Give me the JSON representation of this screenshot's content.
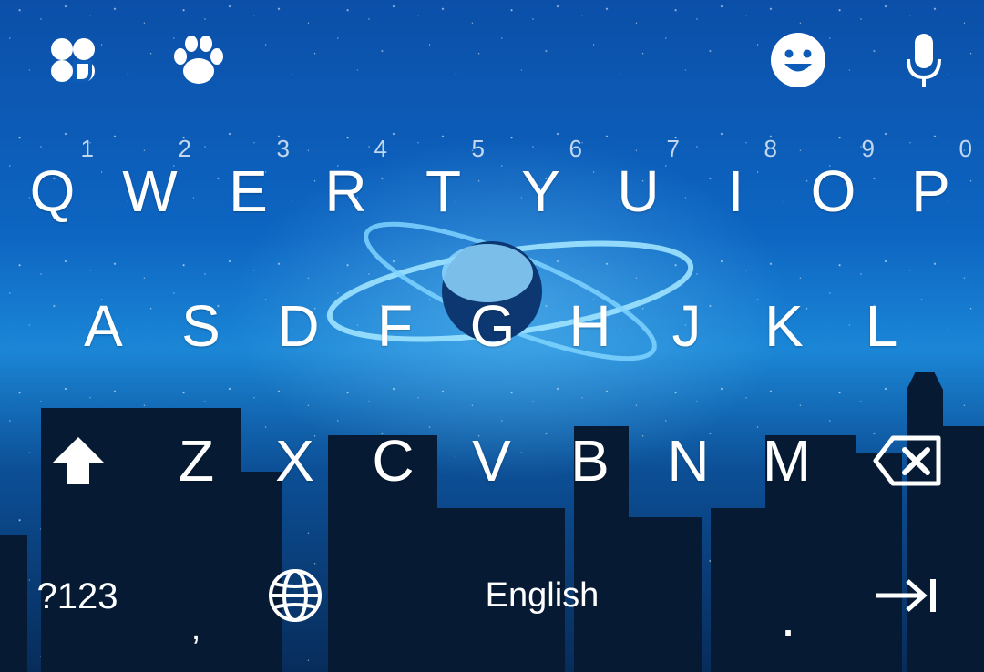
{
  "toolbar": {
    "left_icons": [
      "clover-icon",
      "paw-icon"
    ],
    "right_icons": [
      "emoji-icon",
      "microphone-icon"
    ]
  },
  "keyboard": {
    "row1": [
      {
        "label": "Q",
        "hint": "1"
      },
      {
        "label": "W",
        "hint": "2"
      },
      {
        "label": "E",
        "hint": "3"
      },
      {
        "label": "R",
        "hint": "4"
      },
      {
        "label": "T",
        "hint": "5"
      },
      {
        "label": "Y",
        "hint": "6"
      },
      {
        "label": "U",
        "hint": "7"
      },
      {
        "label": "I",
        "hint": "8"
      },
      {
        "label": "O",
        "hint": "9"
      },
      {
        "label": "P",
        "hint": "0"
      }
    ],
    "row2": [
      {
        "label": "A"
      },
      {
        "label": "S"
      },
      {
        "label": "D"
      },
      {
        "label": "F"
      },
      {
        "label": "G"
      },
      {
        "label": "H"
      },
      {
        "label": "J"
      },
      {
        "label": "K"
      },
      {
        "label": "L"
      }
    ],
    "row3": [
      {
        "label": "Z"
      },
      {
        "label": "X"
      },
      {
        "label": "C"
      },
      {
        "label": "V"
      },
      {
        "label": "B"
      },
      {
        "label": "N"
      },
      {
        "label": "M"
      }
    ],
    "shift_icon": "shift-icon",
    "backspace_icon": "backspace-icon",
    "bottom": {
      "symbols_label": "?123",
      "comma_label": ",",
      "globe_icon": "globe-icon",
      "space_label": "English",
      "period_label": ".",
      "enter_icon": "tab-arrow-icon"
    }
  },
  "colors": {
    "text": "#ffffff",
    "background_top": "#0b4fa8",
    "background_mid": "#1b86d6",
    "skyline": "#061a33"
  }
}
